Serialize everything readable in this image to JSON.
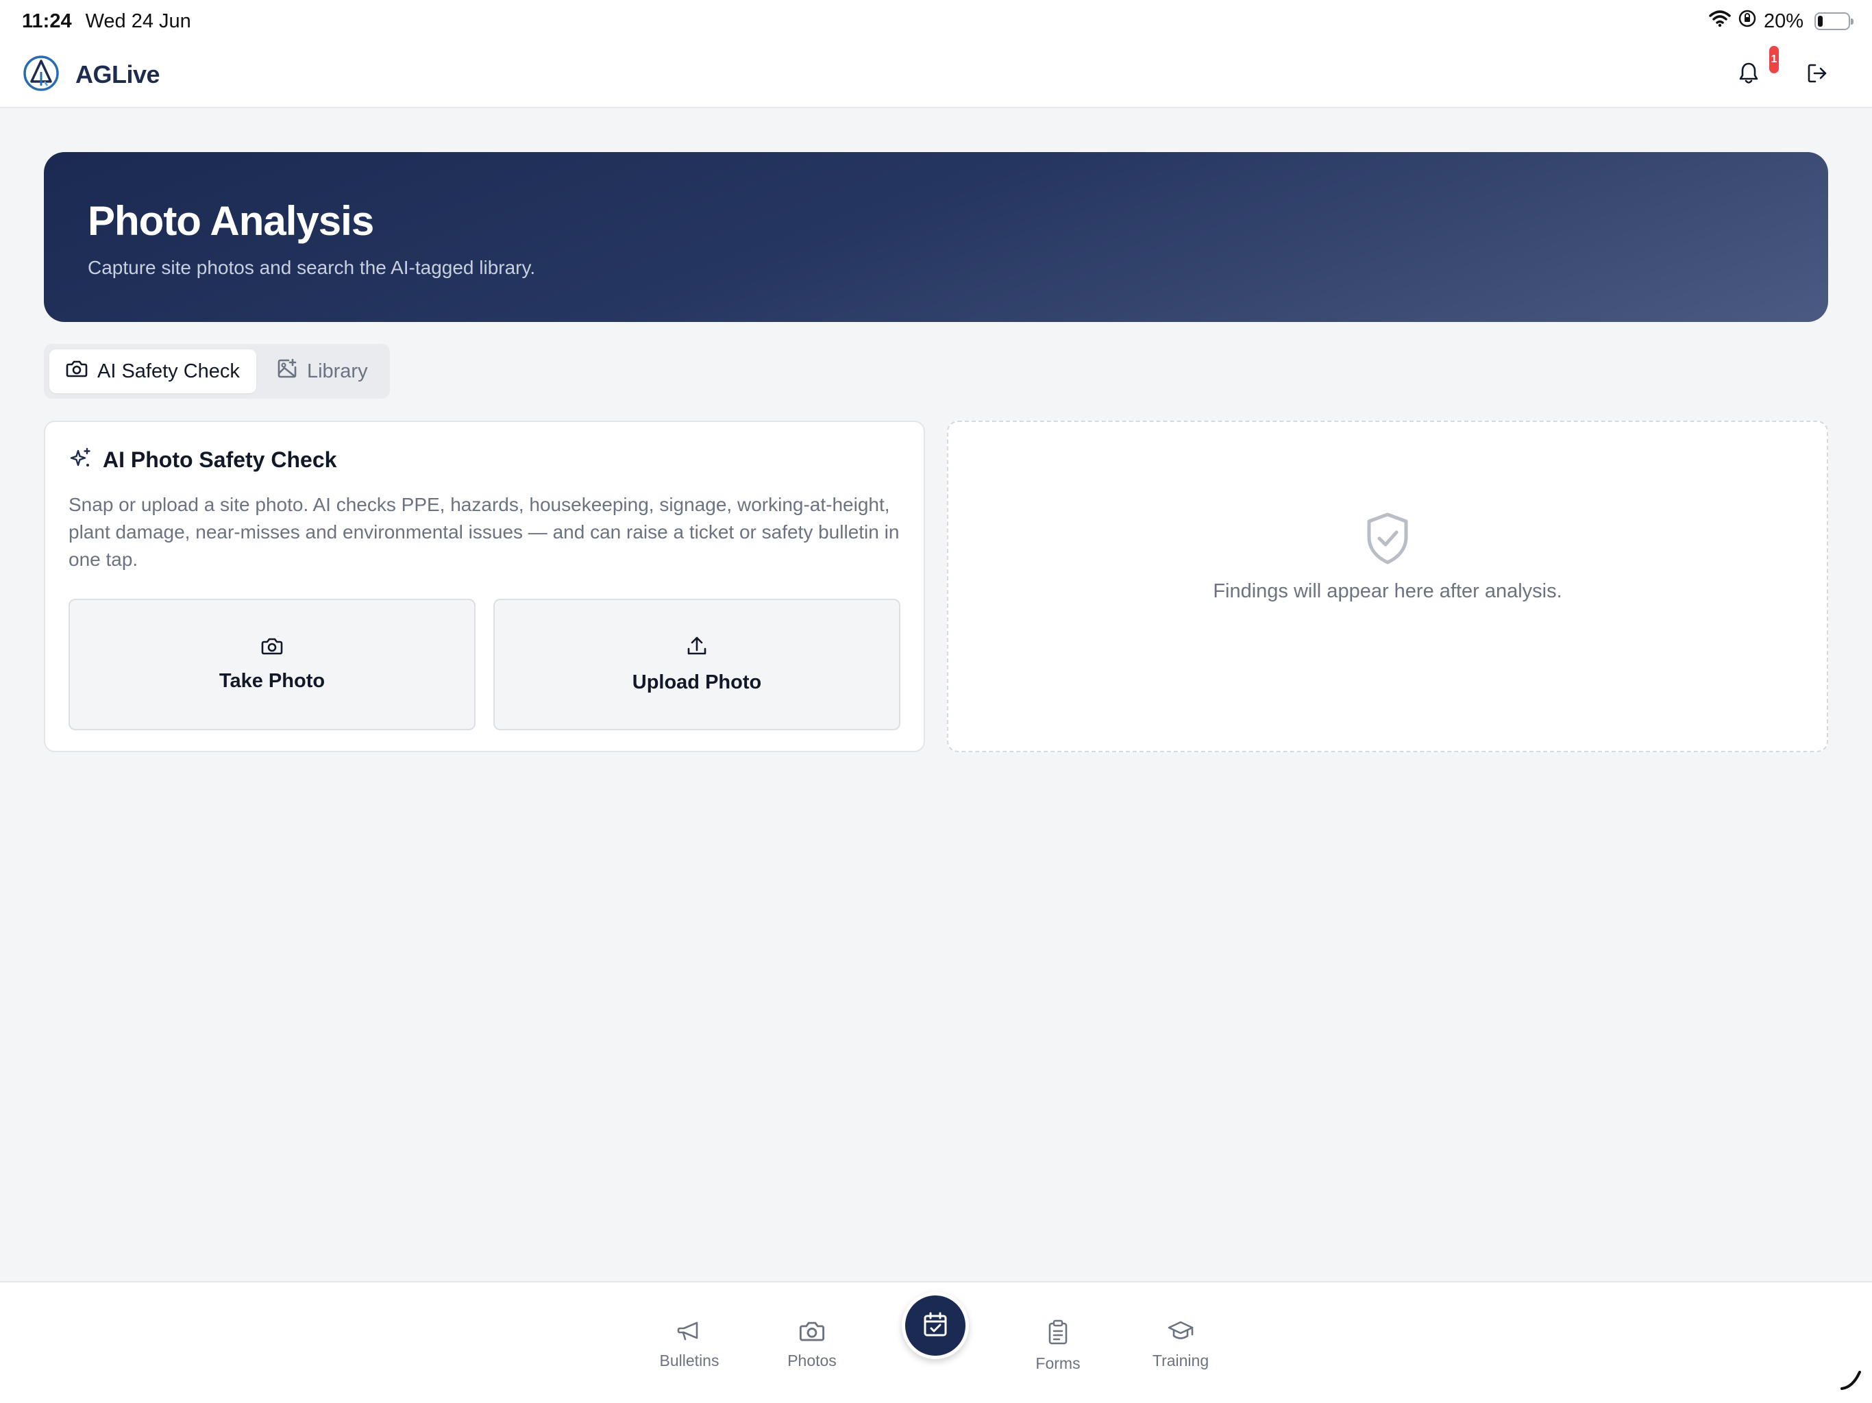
{
  "status_bar": {
    "time": "11:24",
    "date": "Wed 24 Jun",
    "battery": "20%"
  },
  "app": {
    "name": "AGLive",
    "notification_count": "1"
  },
  "hero": {
    "title": "Photo Analysis",
    "subtitle": "Capture site photos and search the AI-tagged library."
  },
  "tabs": [
    {
      "label": "AI Safety Check",
      "active": true
    },
    {
      "label": "Library",
      "active": false
    }
  ],
  "check_card": {
    "title": "AI Photo Safety Check",
    "description": "Snap or upload a site photo. AI checks PPE, hazards, housekeeping, signage, working-at-height, plant damage, near-misses and environmental issues — and can raise a ticket or safety bulletin in one tap.",
    "take_photo": "Take Photo",
    "upload_photo": "Upload Photo"
  },
  "results": {
    "empty_text": "Findings will appear here after analysis."
  },
  "bottom_nav": {
    "items": [
      {
        "label": "Bulletins",
        "icon": "megaphone-icon"
      },
      {
        "label": "Photos",
        "icon": "camera-icon"
      },
      {
        "label": "",
        "icon": "calendar-check-icon"
      },
      {
        "label": "Forms",
        "icon": "clipboard-icon"
      },
      {
        "label": "Training",
        "icon": "graduation-cap-icon"
      }
    ]
  },
  "colors": {
    "brand_navy": "#1b2a52",
    "page_bg": "#f4f5f7",
    "badge_red": "#ef4444",
    "muted_text": "#6b7280"
  }
}
